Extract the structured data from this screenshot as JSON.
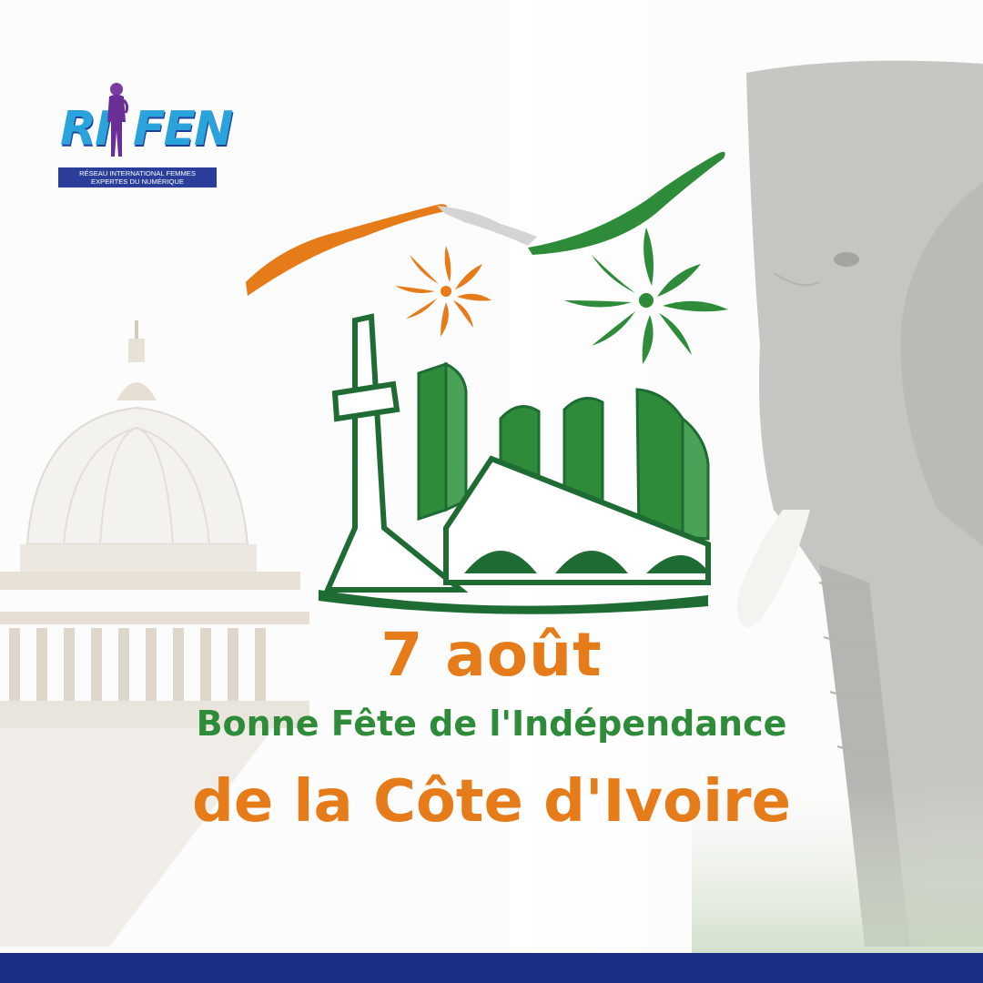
{
  "logo": {
    "word_left": "RI",
    "word_right": "FEN",
    "tagline_line1": "RÉSEAU INTERNATIONAL FEMMES",
    "tagline_line2": "EXPERTES DU NUMÉRIQUE"
  },
  "message": {
    "date": "7 août",
    "greeting": "Bonne Fête de l'Indépendance",
    "country": "de la Côte d'Ivoire"
  },
  "colors": {
    "orange": "#e67b19",
    "green": "#2e8b3a",
    "dark_green": "#1f6b34",
    "navy": "#1b2f87",
    "logo_blue": "#2aa2dc"
  },
  "icons": [
    "basilica-dome-illustration",
    "elephant-illustration",
    "flag-ribbon-icon",
    "firework-icon",
    "cathedral-icon"
  ]
}
